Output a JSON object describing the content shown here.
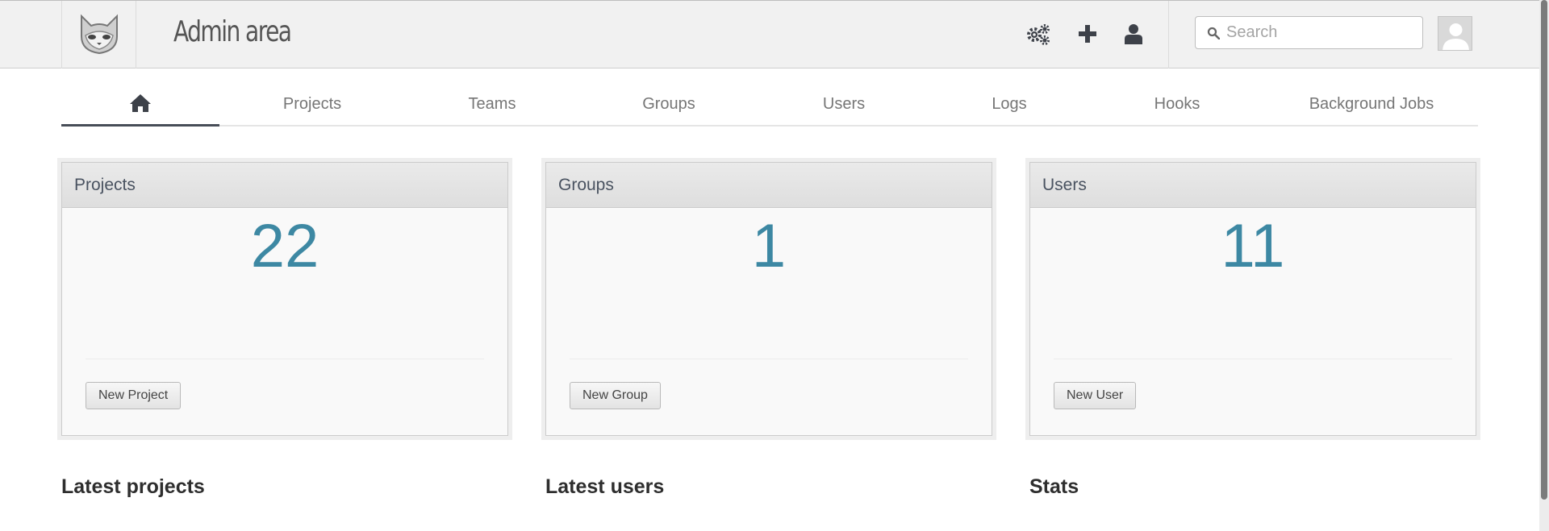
{
  "header": {
    "title": "Admin area",
    "icons": [
      "settings-icon",
      "plus-icon",
      "user-icon"
    ],
    "search": {
      "placeholder": "Search",
      "value": ""
    }
  },
  "nav": {
    "home_icon": "home-icon",
    "tabs": [
      {
        "label": "Projects"
      },
      {
        "label": "Teams"
      },
      {
        "label": "Groups"
      },
      {
        "label": "Users"
      },
      {
        "label": "Logs"
      },
      {
        "label": "Hooks"
      },
      {
        "label": "Background Jobs"
      }
    ]
  },
  "cards": [
    {
      "title": "Projects",
      "count": "22",
      "button": "New Project"
    },
    {
      "title": "Groups",
      "count": "1",
      "button": "New Group"
    },
    {
      "title": "Users",
      "count": "11",
      "button": "New User"
    }
  ],
  "sections": {
    "latest_projects": "Latest projects",
    "latest_users": "Latest users",
    "stats": "Stats"
  },
  "colors": {
    "accent": "#3d88a3",
    "active_tab": "#474d57"
  }
}
